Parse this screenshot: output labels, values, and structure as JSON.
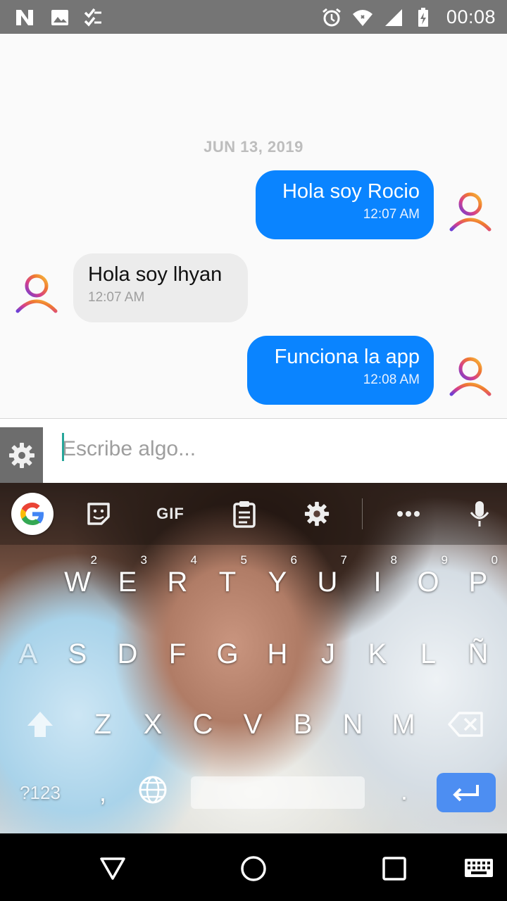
{
  "status_bar": {
    "time": "00:08",
    "icons": [
      "n-notification-icon",
      "image-icon",
      "checklist-icon",
      "alarm-icon",
      "wifi-icon",
      "signal-icon",
      "battery-charging-icon"
    ]
  },
  "chat": {
    "date_separator": "JUN 13, 2019",
    "messages": [
      {
        "direction": "outgoing",
        "text": "Hola soy Rocio",
        "time": "12:07 AM"
      },
      {
        "direction": "incoming",
        "text": "Hola soy lhyan",
        "time": "12:07 AM"
      },
      {
        "direction": "outgoing",
        "text": "Funciona la app",
        "time": "12:08 AM"
      }
    ],
    "colors": {
      "outgoing_bubble": "#0a84ff",
      "incoming_bubble": "#ececec",
      "caret": "#26a69a"
    }
  },
  "composer": {
    "placeholder": "Escribe algo...",
    "value": "",
    "settings_icon": "gear-icon"
  },
  "keyboard": {
    "toolbar": {
      "google": "google-g-icon",
      "sticker": "sticker-icon",
      "gif_label": "GIF",
      "clipboard": "clipboard-icon",
      "settings": "gear-icon",
      "more": "more-dots-icon",
      "voice": "microphone-icon"
    },
    "row1": [
      {
        "key": "W",
        "hint": "2"
      },
      {
        "key": "E",
        "hint": "3"
      },
      {
        "key": "R",
        "hint": "4"
      },
      {
        "key": "T",
        "hint": "5"
      },
      {
        "key": "Y",
        "hint": "6"
      },
      {
        "key": "U",
        "hint": "7"
      },
      {
        "key": "I",
        "hint": "8"
      },
      {
        "key": "O",
        "hint": "9"
      },
      {
        "key": "P",
        "hint": "0"
      }
    ],
    "row2": [
      "A",
      "S",
      "D",
      "F",
      "G",
      "H",
      "J",
      "K",
      "L",
      "Ñ"
    ],
    "row3": [
      "Z",
      "X",
      "C",
      "V",
      "B",
      "N",
      "M"
    ],
    "numbers_key": "?123",
    "comma_key": ",",
    "period_key": ".",
    "accent_color": "#4d8ef2"
  },
  "nav_bar": {
    "back": "back-triangle-icon",
    "home": "home-circle-icon",
    "recents": "recents-square-icon",
    "keyboard": "keyboard-icon"
  }
}
